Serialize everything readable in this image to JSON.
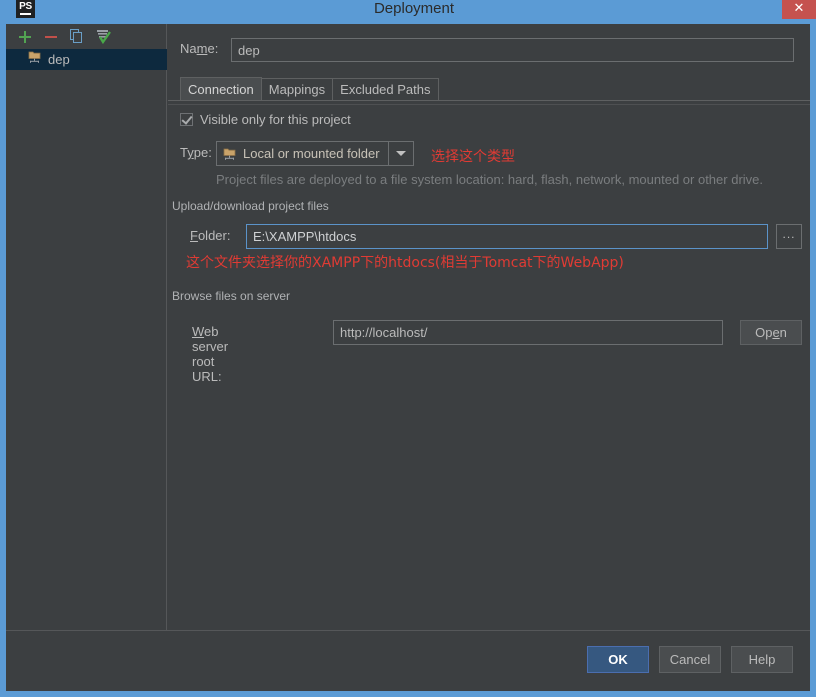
{
  "titlebar": {
    "app_icon": "phpstorm-ps-icon",
    "title": "Deployment",
    "close_label": "✕"
  },
  "toolbar": {
    "add_label": "+",
    "remove_label": "−",
    "copy_icon": "copy-icon",
    "toggle_icon": "set-default-icon"
  },
  "tree": {
    "items": [
      {
        "label": "dep",
        "icon": "local-folder-server-icon",
        "selected": true
      }
    ]
  },
  "form": {
    "name_label_pre": "Na",
    "name_label_mnemonic": "m",
    "name_label_post": "e:",
    "name_value": "dep",
    "name_placeholder": ""
  },
  "tabs": [
    {
      "label": "Connection",
      "active": true
    },
    {
      "label": "Mappings",
      "active": false
    },
    {
      "label": "Excluded Paths",
      "active": false
    }
  ],
  "connection": {
    "visible_only_label": "Visible only for this project",
    "visible_only_checked": true,
    "type_label_pre": "T",
    "type_label_mnemonic": "y",
    "type_label_post": "pe:",
    "type_value": "Local or mounted folder",
    "type_icon": "local-folder-server-icon",
    "helper_text": "Project files are deployed to a file system location: hard, flash, network, mounted or other drive.",
    "group_upload_label": "Upload/download project files",
    "folder_label_pre": "",
    "folder_label_mnemonic": "F",
    "folder_label_post": "older:",
    "folder_value": "E:\\XAMPP\\htdocs",
    "folder_browse_label": "...",
    "group_browse_label": "Browse files on server",
    "url_label_pre": "",
    "url_label_mnemonic": "W",
    "url_label_post": "eb server root URL:",
    "url_value": "http://localhost/",
    "open_label_pre": "Op",
    "open_label_mnemonic": "e",
    "open_label_post": "n"
  },
  "annotations": [
    {
      "text": "选择这个类型",
      "color": "#e03b34"
    },
    {
      "text": "这个文件夹选择你的XAMPP下的htdocs(相当于Tomcat下的WebApp)",
      "color": "#e03b34"
    }
  ],
  "buttons": {
    "ok": "OK",
    "cancel": "Cancel",
    "help": "Help"
  },
  "colors": {
    "window_border": "#5b9bd5",
    "dialog_bg": "#3c3f41",
    "selection_bg": "#0d293e",
    "accent_button": "#365880",
    "annotation_red": "#e03b34",
    "close_red": "#c5524f"
  }
}
